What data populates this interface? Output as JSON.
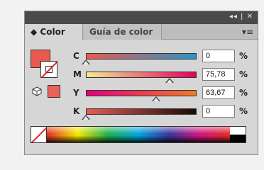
{
  "panel": {
    "titlebar_controls": "◂◂ | ✕",
    "tabs": [
      {
        "label": "◆ Color",
        "active": true
      },
      {
        "label": "Guía de color",
        "active": false
      }
    ],
    "menu_icon": "▾≡"
  },
  "sliders": [
    {
      "label": "C",
      "value": "0",
      "unit": "%",
      "level": 0.0
    },
    {
      "label": "M",
      "value": "75,78",
      "unit": "%",
      "level": 0.7578
    },
    {
      "label": "Y",
      "value": "63,67",
      "unit": "%",
      "level": 0.6367
    },
    {
      "label": "K",
      "value": "0",
      "unit": "%",
      "level": 0.0
    }
  ],
  "colors": {
    "fill": "#e85a4f",
    "out_of_gamut": "#e8625a"
  }
}
